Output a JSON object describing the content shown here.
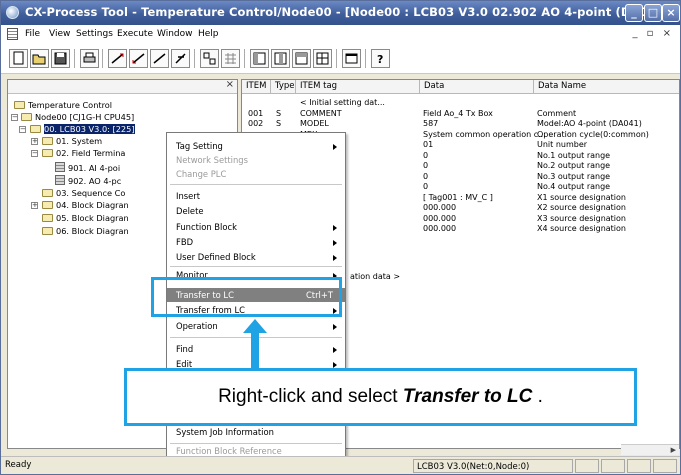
{
  "window": {
    "title": "CX-Process Tool - Temperature Control/Node00 - [Node00 : LCB03 V3.0 02.902 AO 4-point (DA041)]",
    "controls": {
      "min": "_",
      "max": "□",
      "close": "×"
    }
  },
  "menubar": {
    "items": [
      "File",
      "View",
      "Settings",
      "Execute",
      "Window",
      "Help"
    ],
    "mdi_controls": "_ ▫ ×"
  },
  "toolbar": {
    "icons": [
      "new-icon",
      "open-icon",
      "save-icon",
      "print-icon",
      "wire-icon",
      "wire-icon",
      "wire-icon",
      "pen-icon",
      "block-icon",
      "grid-icon",
      "table-icon",
      "table-icon",
      "table-icon",
      "table-icon",
      "window-icon",
      "help-icon"
    ]
  },
  "tree": {
    "close": "×",
    "nodes": [
      {
        "label": "Temperature Control"
      },
      {
        "label": "Node00 [CJ1G-H CPU45]"
      },
      {
        "label": "00. LCB03 V3.0: [225]"
      },
      {
        "label": "01. System"
      },
      {
        "label": "02. Field Termina"
      },
      {
        "label": "901. AI 4-poi"
      },
      {
        "label": "902. AO 4-pc"
      },
      {
        "label": "03. Sequence Co"
      },
      {
        "label": "04. Block Diagran"
      },
      {
        "label": "05. Block Diagran"
      },
      {
        "label": "06. Block Diagran"
      }
    ]
  },
  "list": {
    "columns": [
      "ITEM",
      "Type",
      "ITEM tag",
      "Data",
      "Data Name"
    ],
    "rows": [
      {
        "item": "",
        "type": "",
        "tag": "< Initial setting dat...",
        "data": "",
        "name": ""
      },
      {
        "item": "001",
        "type": "S",
        "tag": "COMMENT",
        "data": "Field Ao_4 Tx Box",
        "name": "Comment"
      },
      {
        "item": "002",
        "type": "S",
        "tag": "MODEL",
        "data": "587",
        "name": "Model:AO 4-point (DA041)"
      },
      {
        "item": "",
        "type": "",
        "tag": "MEX",
        "data": "System common operation c...",
        "name": "Operation cycle(0:common)"
      },
      {
        "item": "",
        "type": "",
        "tag": "",
        "data": "01",
        "name": "Unit number"
      },
      {
        "item": "",
        "type": "",
        "tag": "",
        "data": "0",
        "name": "No.1 output range"
      },
      {
        "item": "",
        "type": "",
        "tag": "",
        "data": "0",
        "name": "No.2 output range"
      },
      {
        "item": "",
        "type": "",
        "tag": "",
        "data": "0",
        "name": "No.3 output range"
      },
      {
        "item": "",
        "type": "",
        "tag": "",
        "data": "0",
        "name": "No.4 output range"
      },
      {
        "item": "",
        "type": "",
        "tag": "",
        "data": "[ Tag001 : MV_C ]",
        "name": "X1 source designation"
      },
      {
        "item": "",
        "type": "",
        "tag": "",
        "data": "000.000",
        "name": "X2 source designation"
      },
      {
        "item": "",
        "type": "",
        "tag": "",
        "data": "000.000",
        "name": "X3 source designation"
      },
      {
        "item": "",
        "type": "",
        "tag": "",
        "data": "000.000",
        "name": "X4 source designation"
      }
    ],
    "partial_row": "ation data >"
  },
  "context_menu": {
    "items": [
      {
        "label": "Tag Setting",
        "submenu": true
      },
      {
        "label": "Network Settings",
        "disabled": true
      },
      {
        "label": "Change PLC",
        "disabled": true
      },
      {
        "label": "Insert"
      },
      {
        "label": "Delete"
      },
      {
        "label": "Function Block",
        "submenu": true
      },
      {
        "label": "FBD",
        "submenu": true
      },
      {
        "label": "User Defined Block",
        "submenu": true
      },
      {
        "label": "Monitor",
        "submenu": true
      },
      {
        "label": "Transfer to LC",
        "shortcut": "Ctrl+T",
        "highlighted": true
      },
      {
        "label": "Transfer from LC",
        "submenu": true
      },
      {
        "label": "Operation",
        "submenu": true
      },
      {
        "label": "Find",
        "submenu": true
      },
      {
        "label": "Edit",
        "submenu": true
      },
      {
        "label": "System Job Information"
      },
      {
        "label": "Function Block Reference",
        "disabled": true
      }
    ]
  },
  "callout": {
    "prefix": "Right-click and select ",
    "emphasis": "Transfer to LC",
    "suffix": " ."
  },
  "statusbar": {
    "left": "Ready",
    "middle": "LCB03 V3.0(Net:0,Node:0)"
  },
  "colors": {
    "title_bar": "#3f5e9b",
    "callout_border": "#1fa3e4",
    "menu_highlight": "#808080"
  }
}
